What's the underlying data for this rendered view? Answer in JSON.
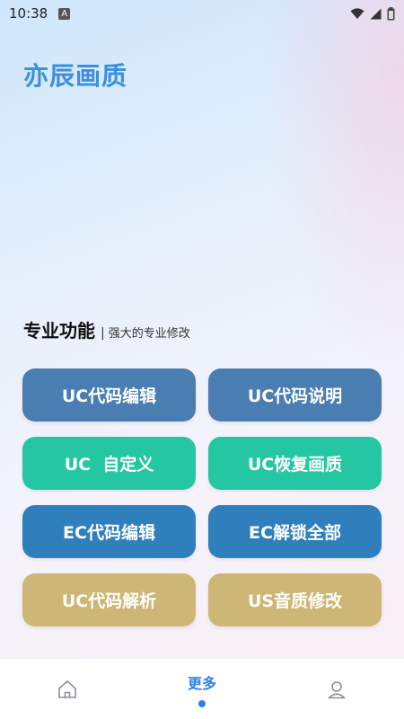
{
  "status_bar": {
    "time": "10:38",
    "icons": [
      "notification-a-icon",
      "wifi-icon",
      "signal-icon",
      "battery-icon"
    ]
  },
  "app": {
    "title": "亦辰画质"
  },
  "section": {
    "title": "专业功能",
    "divider": "|",
    "subtitle": "强大的专业修改"
  },
  "buttons": [
    {
      "label": "UC代码编辑",
      "color": "#4a7db2"
    },
    {
      "label": "UC代码说明",
      "color": "#4a7db2"
    },
    {
      "label": "UC  自定义",
      "color": "#25c6a2"
    },
    {
      "label": "UC恢复画质",
      "color": "#25c6a2"
    },
    {
      "label": "EC代码编辑",
      "color": "#2f7fbd"
    },
    {
      "label": "EC解锁全部",
      "color": "#2f7fbd"
    },
    {
      "label": "UC代码解析",
      "color": "#cdb676"
    },
    {
      "label": "US音质修改",
      "color": "#cdb676"
    }
  ],
  "bottom_nav": {
    "items": [
      {
        "icon": "home-icon",
        "label": ""
      },
      {
        "icon": "",
        "label": "更多",
        "active": true
      },
      {
        "icon": "user-icon",
        "label": ""
      }
    ],
    "accent": "#2f7ff0"
  }
}
